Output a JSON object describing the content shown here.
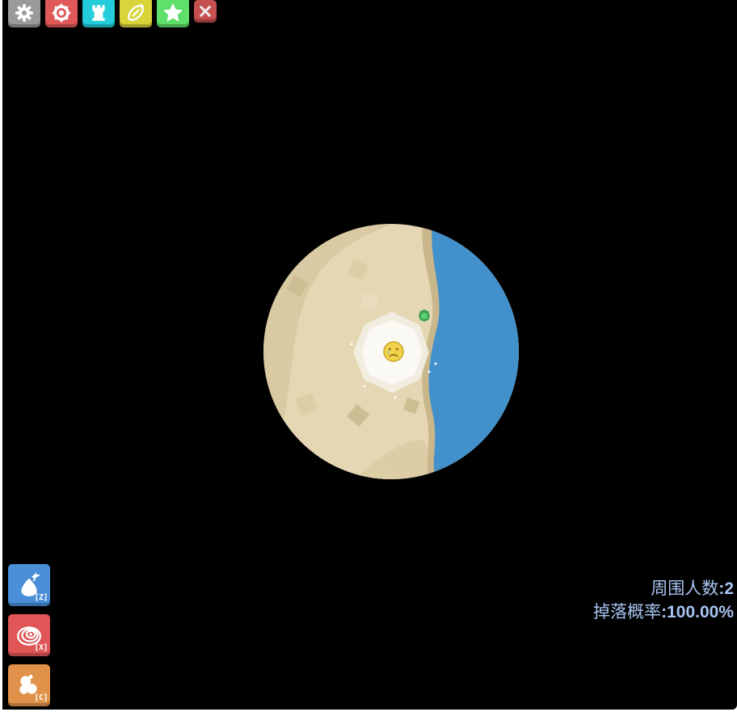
{
  "top_toolbar": {
    "buttons": [
      {
        "name": "settings",
        "icon": "gear-icon",
        "color": "#9a9a9a"
      },
      {
        "name": "target",
        "icon": "target-ring-icon",
        "color": "#e05858"
      },
      {
        "name": "castle",
        "icon": "rook-tower-icon",
        "color": "#22ccd8"
      },
      {
        "name": "rugby",
        "icon": "rugby-ball-icon",
        "color": "#d8d43a"
      },
      {
        "name": "star",
        "icon": "star-icon",
        "color": "#5fe06a"
      }
    ],
    "close": {
      "icon": "close-icon",
      "color": "#c65050"
    }
  },
  "skills": [
    {
      "name": "skill-z",
      "icon": "water-drop-bag-icon",
      "key": "[Z]",
      "color": "#4a8fd8"
    },
    {
      "name": "skill-x",
      "icon": "vortex-swirl-icon",
      "key": "[X]",
      "color": "#e05555"
    },
    {
      "name": "skill-c",
      "icon": "bubbles-icon",
      "key": "[C]",
      "color": "#e0924a"
    }
  ],
  "stats": {
    "nearby_label": "周围人数",
    "nearby_value": "2",
    "drop_label": "掉落概率",
    "drop_value": "100.00%"
  },
  "map": {
    "sand": "#e5d7b3",
    "sand_dark": "#d6c69d",
    "water": "#4391cc",
    "player_face": "sad-face-icon"
  }
}
